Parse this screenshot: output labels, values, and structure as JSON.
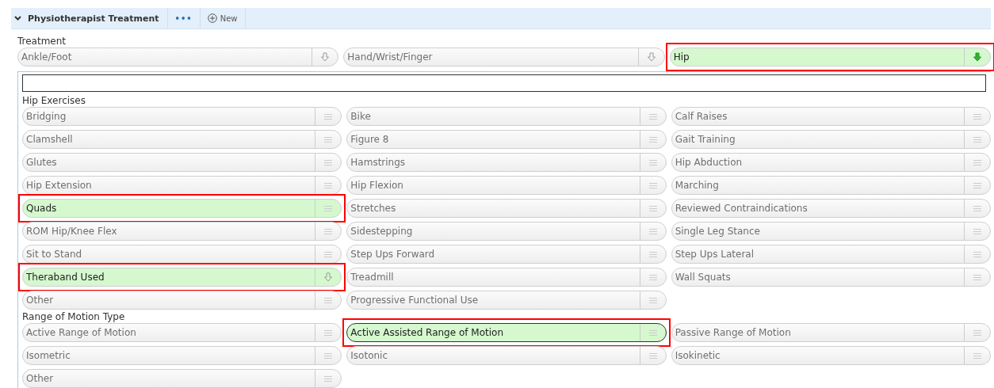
{
  "header": {
    "title": "Physiotherapist Treatment",
    "expanded": true,
    "more_button": "•••",
    "new_button": "New"
  },
  "treatment": {
    "label": "Treatment",
    "options": [
      {
        "label": "Ankle/Foot",
        "kind": "dropdown",
        "selected": false,
        "highlighted": false
      },
      {
        "label": "Hand/Wrist/Finger",
        "kind": "dropdown",
        "selected": false,
        "highlighted": false
      },
      {
        "label": "Hip",
        "kind": "dropdown",
        "selected": true,
        "highlighted": true
      }
    ]
  },
  "panel": {
    "sections": [
      {
        "title": "Hip Exercises",
        "items": [
          {
            "label": "Bridging",
            "kind": "list",
            "selected": false,
            "highlighted": false
          },
          {
            "label": "Bike",
            "kind": "list",
            "selected": false,
            "highlighted": false
          },
          {
            "label": "Calf Raises",
            "kind": "list",
            "selected": false,
            "highlighted": false
          },
          {
            "label": "Clamshell",
            "kind": "list",
            "selected": false,
            "highlighted": false
          },
          {
            "label": "Figure 8",
            "kind": "list",
            "selected": false,
            "highlighted": false
          },
          {
            "label": "Gait Training",
            "kind": "list",
            "selected": false,
            "highlighted": false
          },
          {
            "label": "Glutes",
            "kind": "list",
            "selected": false,
            "highlighted": false
          },
          {
            "label": "Hamstrings",
            "kind": "list",
            "selected": false,
            "highlighted": false
          },
          {
            "label": "Hip Abduction",
            "kind": "list",
            "selected": false,
            "highlighted": false
          },
          {
            "label": "Hip Extension",
            "kind": "list",
            "selected": false,
            "highlighted": false
          },
          {
            "label": "Hip Flexion",
            "kind": "list",
            "selected": false,
            "highlighted": false
          },
          {
            "label": "Marching",
            "kind": "list",
            "selected": false,
            "highlighted": false
          },
          {
            "label": "Quads",
            "kind": "list",
            "selected": true,
            "highlighted": true
          },
          {
            "label": "Stretches",
            "kind": "list",
            "selected": false,
            "highlighted": false
          },
          {
            "label": "Reviewed Contraindications",
            "kind": "list",
            "selected": false,
            "highlighted": false
          },
          {
            "label": "ROM Hip/Knee Flex",
            "kind": "list",
            "selected": false,
            "highlighted": false
          },
          {
            "label": "Sidestepping",
            "kind": "list",
            "selected": false,
            "highlighted": false
          },
          {
            "label": "Single Leg Stance",
            "kind": "list",
            "selected": false,
            "highlighted": false
          },
          {
            "label": "Sit to Stand",
            "kind": "list",
            "selected": false,
            "highlighted": false
          },
          {
            "label": "Step Ups Forward",
            "kind": "list",
            "selected": false,
            "highlighted": false
          },
          {
            "label": "Step Ups Lateral",
            "kind": "list",
            "selected": false,
            "highlighted": false
          },
          {
            "label": "Theraband Used",
            "kind": "dropdown",
            "selected": true,
            "highlighted": true
          },
          {
            "label": "Treadmill",
            "kind": "list",
            "selected": false,
            "highlighted": false
          },
          {
            "label": "Wall Squats",
            "kind": "list",
            "selected": false,
            "highlighted": false
          },
          {
            "label": "Other",
            "kind": "list",
            "selected": false,
            "highlighted": false
          },
          {
            "label": "Progressive Functional Use",
            "kind": "list",
            "selected": false,
            "highlighted": false
          }
        ]
      },
      {
        "title": "Range of Motion Type",
        "items": [
          {
            "label": "Active Range of Motion",
            "kind": "list",
            "selected": false,
            "highlighted": false
          },
          {
            "label": "Active Assisted Range of Motion",
            "kind": "list",
            "selected": true,
            "highlighted": true,
            "focused": true
          },
          {
            "label": "Passive Range of Motion",
            "kind": "list",
            "selected": false,
            "highlighted": false
          },
          {
            "label": "Isometric",
            "kind": "list",
            "selected": false,
            "highlighted": false
          },
          {
            "label": "Isotonic",
            "kind": "list",
            "selected": false,
            "highlighted": false
          },
          {
            "label": "Isokinetic",
            "kind": "list",
            "selected": false,
            "highlighted": false
          },
          {
            "label": "Other",
            "kind": "list",
            "selected": false,
            "highlighted": false
          }
        ]
      }
    ]
  }
}
